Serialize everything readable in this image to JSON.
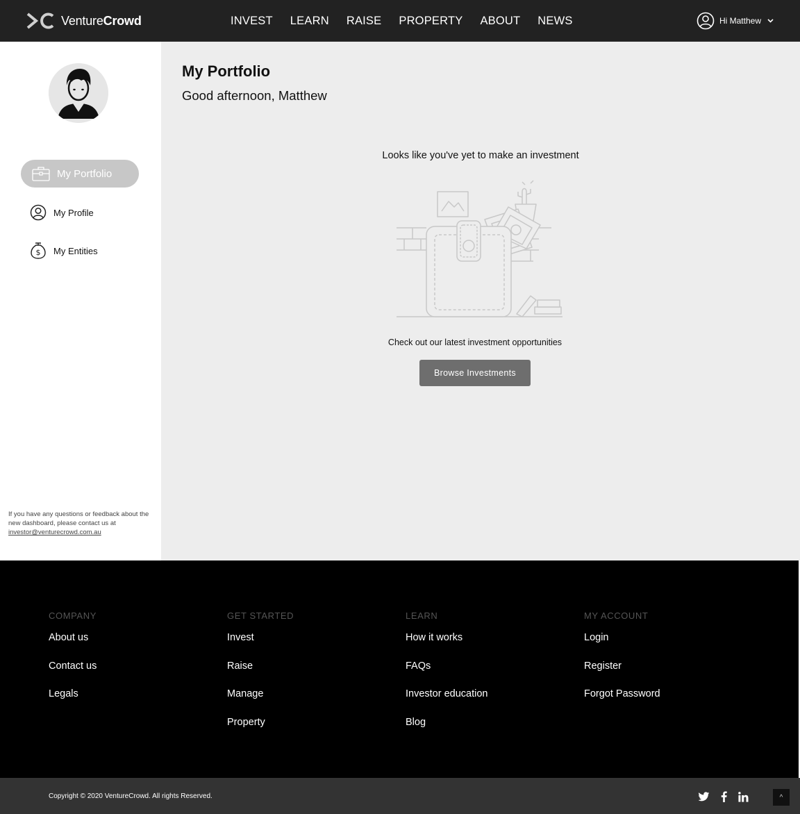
{
  "header": {
    "logo_light": "Venture",
    "logo_bold": "Crowd",
    "nav": [
      "INVEST",
      "LEARN",
      "RAISE",
      "PROPERTY",
      "ABOUT",
      "NEWS"
    ],
    "user_greeting": "Hi Matthew",
    "user_icon": "user-circle-icon",
    "chevron_icon": "chevron-down-icon"
  },
  "sidebar": {
    "items": [
      {
        "label": "My Portfolio",
        "icon": "briefcase-icon",
        "active": true
      },
      {
        "label": "My Profile",
        "icon": "user-circle-icon",
        "active": false
      },
      {
        "label": "My Entities",
        "icon": "money-bag-icon",
        "active": false
      }
    ],
    "note_text": "If you have any questions or feedback about the new dashboard, please contact us at",
    "note_email": "investor@venturecrowd.com.au"
  },
  "main": {
    "title": "My Portfolio",
    "greeting": "Good afternoon, Matthew",
    "empty_heading": "Looks like you've yet to make an investment",
    "empty_illustration": "empty-wallet-illustration",
    "cta_text": "Check out our latest investment opportunities",
    "cta_button": "Browse Investments"
  },
  "footer": {
    "columns": [
      {
        "heading": "COMPANY",
        "links": [
          "About us",
          "Contact us",
          "Legals"
        ]
      },
      {
        "heading": "GET STARTED",
        "links": [
          "Invest",
          "Raise",
          "Manage",
          "Property"
        ]
      },
      {
        "heading": "LEARN",
        "links": [
          "How it works",
          "FAQs",
          "Investor education",
          "Blog"
        ]
      },
      {
        "heading": "MY ACCOUNT",
        "links": [
          "Login",
          "Register",
          "Forgot Password"
        ]
      }
    ],
    "copyright": "Copyright © 2020 VentureCrowd. All rights Reserved.",
    "socials": [
      "twitter-icon",
      "facebook-icon",
      "linkedin-icon"
    ],
    "to_top_label": "^"
  },
  "colors": {
    "header_bg": "#222222",
    "main_bg": "#ededed",
    "active_pill": "#c7c7c7",
    "button_bg": "#6e6e6e",
    "footer_bg": "#000000",
    "bottom_bar_bg": "#333333"
  }
}
